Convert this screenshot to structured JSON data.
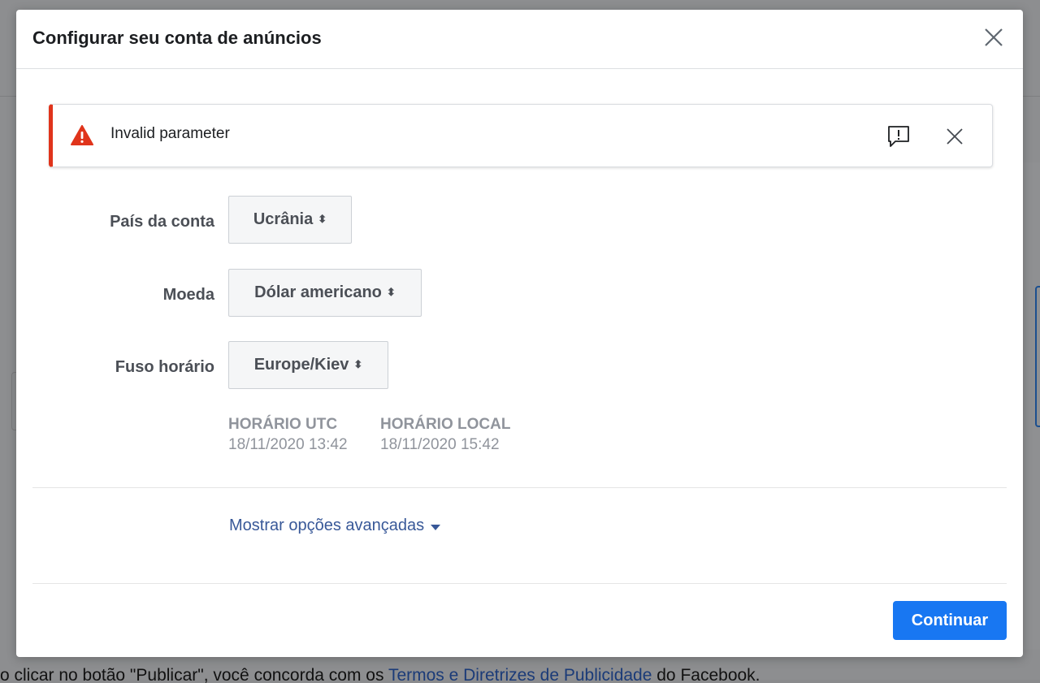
{
  "background": {
    "footer_prefix": "o clicar no botão \"Publicar\", você concorda com os ",
    "footer_link": "Termos e Diretrizes de Publicidade",
    "footer_suffix": " do Facebook."
  },
  "modal": {
    "title": "Configurar seu conta de anúncios",
    "close_icon": "close-icon"
  },
  "alert": {
    "message": "Invalid parameter",
    "icon": "warning-icon",
    "feedback_icon": "feedback-icon",
    "accent_color": "#e0341b"
  },
  "form": {
    "country": {
      "label": "País da conta",
      "value": "Ucrânia"
    },
    "currency": {
      "label": "Moeda",
      "value": "Dólar americano"
    },
    "timezone": {
      "label": "Fuso horário",
      "value": "Europe/Kiev"
    },
    "utc": {
      "label": "HORÁRIO UTC",
      "value": "18/11/2020 13:42"
    },
    "local": {
      "label": "HORÁRIO LOCAL",
      "value": "18/11/2020 15:42"
    }
  },
  "advanced_link": "Mostrar opções avançadas",
  "footer": {
    "continue_label": "Continuar",
    "primary_color": "#1877f2"
  }
}
